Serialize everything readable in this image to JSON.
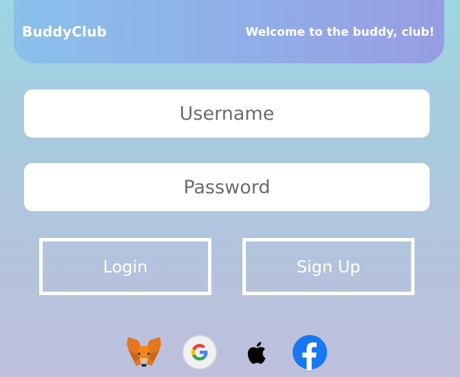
{
  "header": {
    "brand": "BuddyClub",
    "welcome": "Welcome to the buddy, club!"
  },
  "form": {
    "username_placeholder": "Username",
    "password_placeholder": "Password",
    "username_value": "",
    "password_value": ""
  },
  "buttons": {
    "login_label": "Login",
    "signup_label": "Sign Up"
  },
  "social": [
    {
      "name": "metamask-icon"
    },
    {
      "name": "google-icon"
    },
    {
      "name": "apple-icon"
    },
    {
      "name": "facebook-icon"
    }
  ],
  "colors": {
    "header_start": "#8ac0ea",
    "header_end": "#979de2",
    "background_top": "#9dd6e2",
    "background_bottom": "#bec0dd",
    "facebook_blue": "#1877f2",
    "metamask_orange": "#e2761b"
  }
}
